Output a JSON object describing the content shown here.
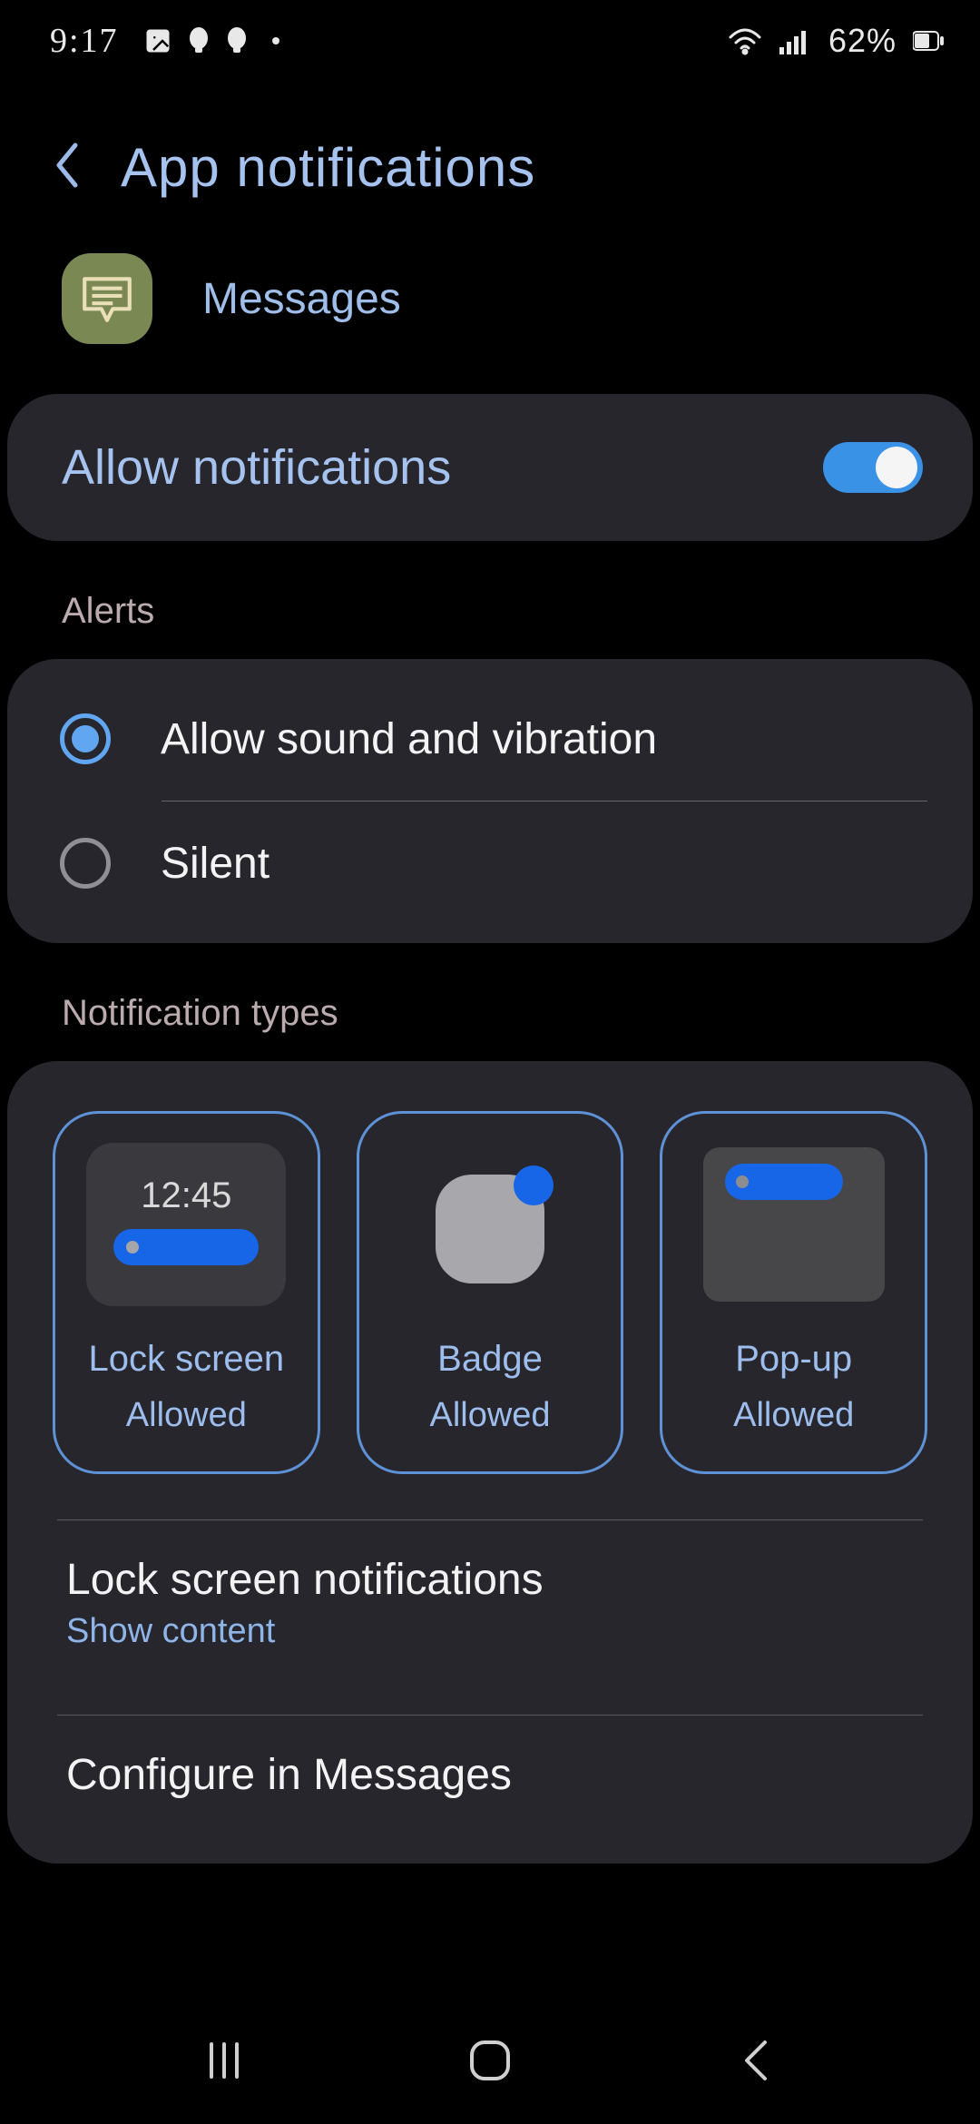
{
  "status": {
    "time": "9:17",
    "battery_pct": "62%"
  },
  "header": {
    "title": "App notifications"
  },
  "app": {
    "name": "Messages"
  },
  "allow": {
    "label": "Allow notifications",
    "on": true
  },
  "sections": {
    "alerts_label": "Alerts",
    "types_label": "Notification types"
  },
  "alerts": {
    "sound": {
      "label": "Allow sound and vibration",
      "selected": true
    },
    "silent": {
      "label": "Silent",
      "selected": false
    }
  },
  "types": {
    "lock": {
      "title": "Lock screen",
      "status": "Allowed",
      "time": "12:45"
    },
    "badge": {
      "title": "Badge",
      "status": "Allowed"
    },
    "popup": {
      "title": "Pop-up",
      "status": "Allowed"
    }
  },
  "lock_notifications": {
    "title": "Lock screen notifications",
    "sub": "Show content"
  },
  "configure": {
    "title": "Configure in Messages"
  }
}
